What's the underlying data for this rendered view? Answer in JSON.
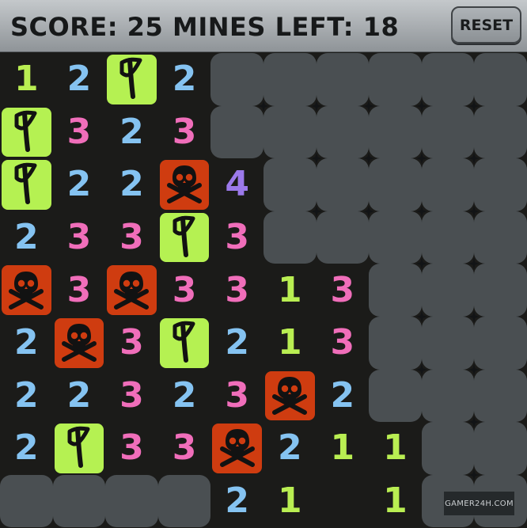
{
  "header": {
    "score_text": "SCORE: 25",
    "mines_text": "MINES LEFT: 18",
    "reset_label": "RESET"
  },
  "board": {
    "rows": 9,
    "cols": 10,
    "cells": [
      [
        "1",
        "2",
        "F",
        "2",
        "C",
        "C",
        "C",
        "C",
        "C",
        "C"
      ],
      [
        "F",
        "3",
        "2",
        "3",
        "C",
        "C",
        "C",
        "C",
        "C",
        "C"
      ],
      [
        "F",
        "2",
        "2",
        "M",
        "4",
        "C",
        "C",
        "C",
        "C",
        "C"
      ],
      [
        "2",
        "3",
        "3",
        "F",
        "3",
        "C",
        "C",
        "C",
        "C",
        "C"
      ],
      [
        "M",
        "3",
        "M",
        "3",
        "3",
        "1",
        "3",
        "C",
        "C",
        "C"
      ],
      [
        "2",
        "M",
        "3",
        "F",
        "2",
        "1",
        "3",
        "C",
        "C",
        "C"
      ],
      [
        "2",
        "2",
        "3",
        "2",
        "3",
        "M",
        "2",
        "C",
        "C",
        "C"
      ],
      [
        "2",
        "F",
        "3",
        "3",
        "M",
        "2",
        "1",
        "1",
        "C",
        "C"
      ],
      [
        "C",
        "C",
        "C",
        "C",
        "2",
        "1",
        "",
        "1",
        "C",
        "C"
      ]
    ]
  },
  "colors": {
    "one": "#b9ee52",
    "two": "#85c3f1",
    "three": "#f06eba",
    "four": "#9b79ea",
    "flag_bg": "#b5f152",
    "mine_bg": "#cf3c10",
    "covered": "#4a4f52",
    "board_bg": "#1b1b19"
  },
  "icons": {
    "flag": "flag-icon",
    "mine": "skull-crossbones-icon",
    "sparkle": "sparkle-icon"
  },
  "watermark": "GAMER24H.COM"
}
